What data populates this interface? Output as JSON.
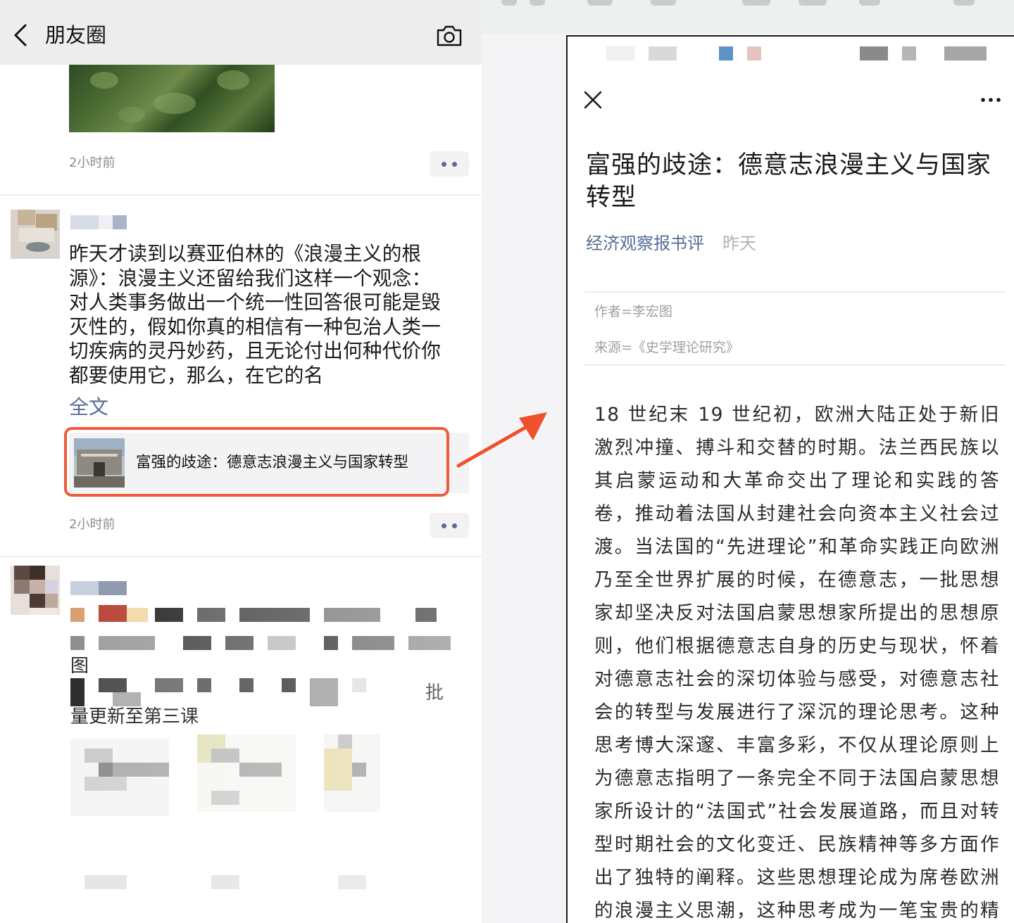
{
  "moments": {
    "header": {
      "title": "朋友圈"
    },
    "post1": {
      "time": "2小时前"
    },
    "post2": {
      "text": "昨天才读到以赛亚伯林的《浪漫主义的根源》：浪漫主义还留给我们这样一个观念：对人类事务做出一个统一性回答很可能是毁灭性的，假如你真的相信有一种包治人类一切疾病的灵丹妙药，且无论付出何种代价你都要使用它，那么，在它的名",
      "full_text_link": "全文",
      "link_card_title": "富强的歧途：德意志浪漫主义与国家转型",
      "time": "2小时前"
    },
    "post3": {
      "partial_text_1": "图",
      "partial_text_2": "量更新至第三课",
      "partial_text_3": "批"
    }
  },
  "article": {
    "title": "富强的歧途：德意志浪漫主义与国家转型",
    "account": "经济观察报书评",
    "date": "昨天",
    "author_line": "作者=李宏图",
    "source_line": "来源=《史学理论研究》",
    "body": "18 世纪末 19 世纪初，欧洲大陆正处于新旧激烈冲撞、搏斗和交替的时期。法兰西民族以其启蒙运动和大革命交出了理论和实践的答卷，推动着法国从封建社会向资本主义社会过渡。当法国的“先进理论”和革命实践正向欧洲乃至全世界扩展的时候，在德意志，一批思想家却坚决反对法国启蒙思想家所提出的思想原则，他们根据德意志自身的历史与现状，怀着对德意志社会的深切体验与感受，对德意志社会的转型与发展进行了深沉的理论思考。这种思考博大深邃、丰富多彩，不仅从理论原则上为德意志指明了一条完全不同于法国启蒙思想家所设计的“法国式”社会发展道路，而且对转型时期社会的文化变迁、民族精神等多方面作出了独特的阐释。这些思想理论成为席卷欧洲的浪漫主义思潮，这种思考成为一笔宝贵的精神遗"
  },
  "colors": {
    "link_blue": "#576b95",
    "highlight_red": "#ee5a3a",
    "arrow_orange": "#f0502d",
    "header_gray": "#ededed"
  },
  "icons": [
    "back-arrow-icon",
    "camera-icon",
    "close-icon",
    "more-dots-icon",
    "arrow-icon"
  ]
}
